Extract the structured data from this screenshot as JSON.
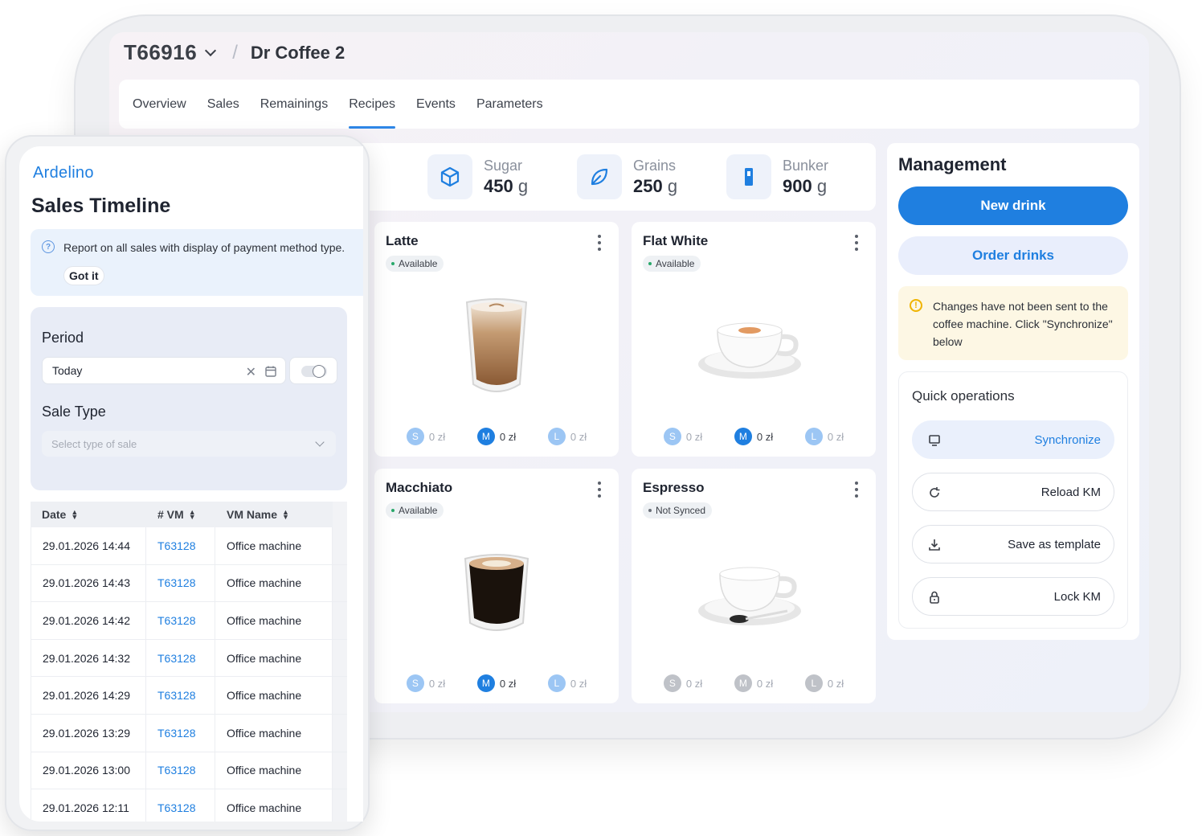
{
  "machine": {
    "id": "T66916",
    "name": "Dr Coffee 2"
  },
  "tabs": [
    "Overview",
    "Sales",
    "Remainings",
    "Recipes",
    "Events",
    "Parameters"
  ],
  "active_tab": "Recipes",
  "stats": [
    {
      "label": "Sugar",
      "value": "450",
      "unit": "g",
      "icon": "cube-icon"
    },
    {
      "label": "Grains",
      "value": "250",
      "unit": "g",
      "icon": "leaf-icon"
    },
    {
      "label": "Bunker",
      "value": "900",
      "unit": "g",
      "icon": "bunker-icon"
    }
  ],
  "drinks": [
    {
      "name": "Latte",
      "status": "Available",
      "sizes": [
        {
          "s": "S",
          "p": "0 zł"
        },
        {
          "s": "M",
          "p": "0 zł"
        },
        {
          "s": "L",
          "p": "0 zł"
        }
      ]
    },
    {
      "name": "Flat White",
      "status": "Available",
      "sizes": [
        {
          "s": "S",
          "p": "0 zł"
        },
        {
          "s": "M",
          "p": "0 zł"
        },
        {
          "s": "L",
          "p": "0 zł"
        }
      ]
    },
    {
      "name": "Macchiato",
      "status": "Available",
      "sizes": [
        {
          "s": "S",
          "p": "0 zł"
        },
        {
          "s": "M",
          "p": "0 zł"
        },
        {
          "s": "L",
          "p": "0 zł"
        }
      ]
    },
    {
      "name": "Espresso",
      "status": "Not Synced",
      "sizes": [
        {
          "s": "S",
          "p": "0 zł"
        },
        {
          "s": "M",
          "p": "0 zł"
        },
        {
          "s": "L",
          "p": "0 zł"
        }
      ]
    }
  ],
  "management": {
    "title": "Management",
    "new_drink": "New drink",
    "order_drinks": "Order drinks",
    "warning": "Changes have not been sent to the coffee machine. Click \"Synchronize\" below",
    "quick_title": "Quick operations",
    "ops": [
      "Synchronize",
      "Reload KM",
      "Save as template",
      "Lock KM"
    ]
  },
  "phone": {
    "brand": "Ardelino",
    "title": "Sales Timeline",
    "info_text": "Report on all sales with display of payment method type.",
    "got_it": "Got it",
    "period_label": "Period",
    "period_value": "Today",
    "sale_type_label": "Sale Type",
    "sale_type_placeholder": "Select type of sale",
    "columns": [
      "Date",
      "# VM",
      "VM Name"
    ],
    "rows": [
      [
        "29.01.2026 14:44",
        "T63128",
        "Office machine"
      ],
      [
        "29.01.2026 14:43",
        "T63128",
        "Office machine"
      ],
      [
        "29.01.2026 14:42",
        "T63128",
        "Office machine"
      ],
      [
        "29.01.2026 14:32",
        "T63128",
        "Office machine"
      ],
      [
        "29.01.2026 14:29",
        "T63128",
        "Office machine"
      ],
      [
        "29.01.2026 13:29",
        "T63128",
        "Office machine"
      ],
      [
        "29.01.2026 13:00",
        "T63128",
        "Office machine"
      ],
      [
        "29.01.2026 12:11",
        "T63128",
        "Office machine"
      ]
    ]
  },
  "colors": {
    "accent": "#1f7fe0",
    "available": "#29a86a",
    "warning_bg": "#fdf7e4",
    "warning_icon": "#f0b400"
  }
}
